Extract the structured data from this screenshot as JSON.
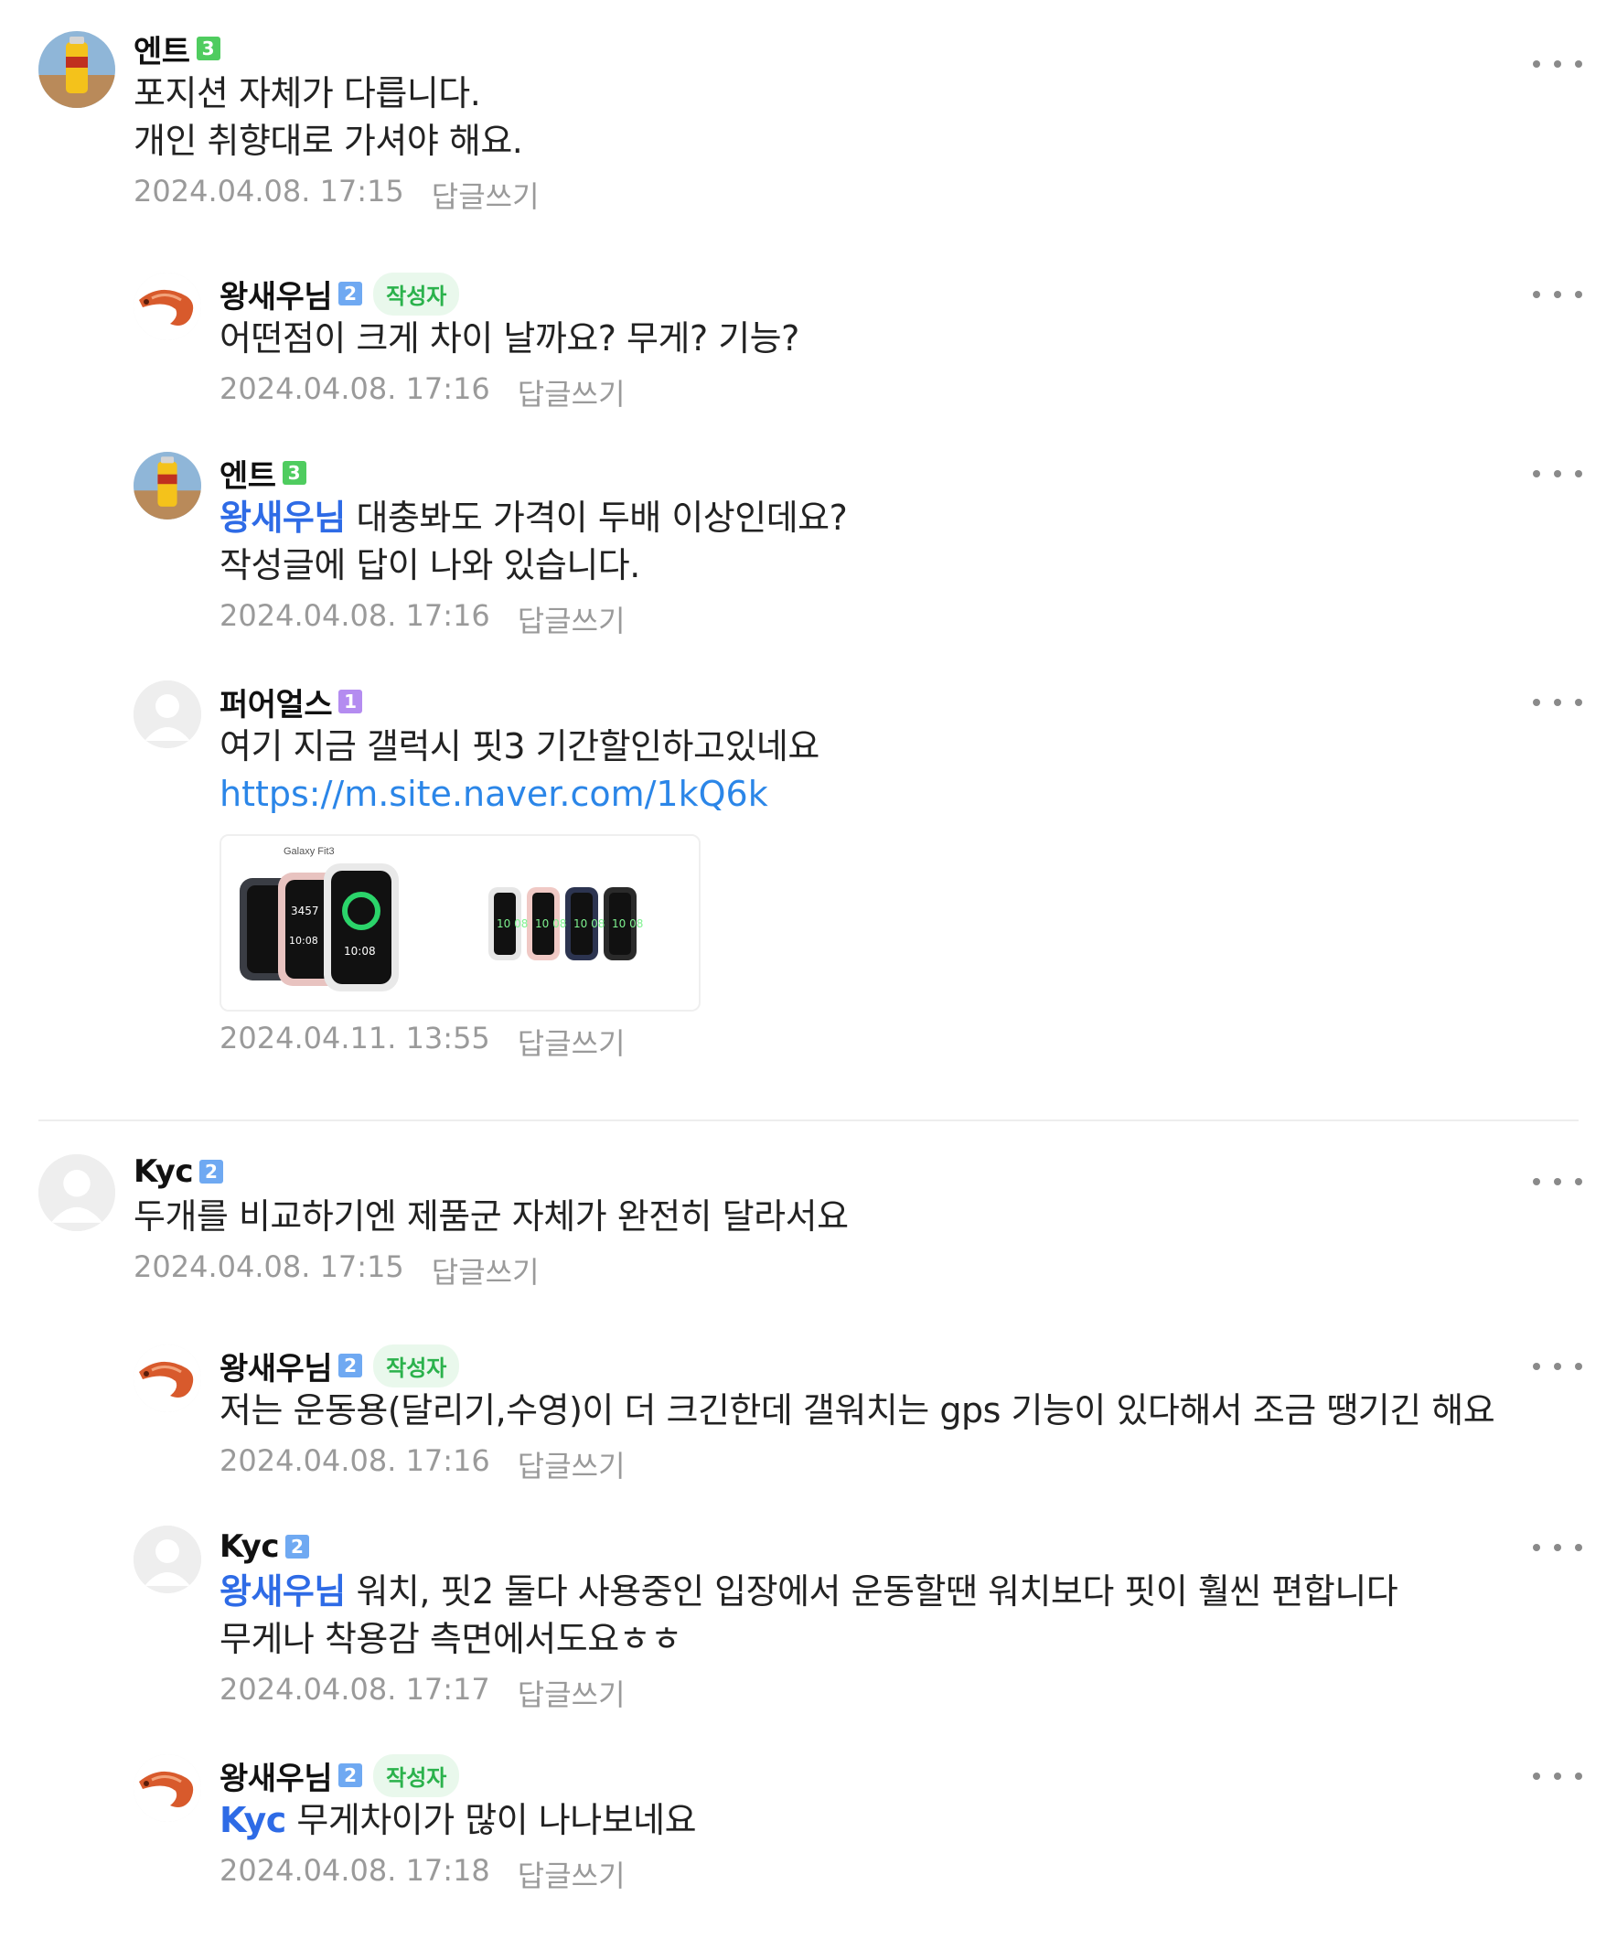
{
  "comments": [
    {
      "nickname": "엔트",
      "level": "3",
      "author_badge": "",
      "lines": [
        "포지션 자체가 다릅니다.",
        "개인 취향대로 가셔야 해요."
      ],
      "mention": "",
      "link": "",
      "date": "2024.04.08. 17:15",
      "reply_label": "답글쓰기",
      "avatar": "cola-icon"
    },
    {
      "nickname": "왕새우님",
      "level": "2",
      "author_badge": "작성자",
      "lines": [
        "어떤점이 크게 차이 날까요? 무게? 기능?"
      ],
      "mention": "",
      "link": "",
      "date": "2024.04.08. 17:16",
      "reply_label": "답글쓰기",
      "avatar": "shrimp-icon"
    },
    {
      "nickname": "엔트",
      "level": "3",
      "author_badge": "",
      "mention": "왕새우님",
      "lines": [
        "대충봐도 가격이 두배 이상인데요?",
        "작성글에 답이 나와 있습니다."
      ],
      "link": "",
      "date": "2024.04.08. 17:16",
      "reply_label": "답글쓰기",
      "avatar": "cola-icon"
    },
    {
      "nickname": "퍼어얼스",
      "level": "1",
      "author_badge": "",
      "lines": [
        "여기 지금 갤럭시 핏3 기간할인하고있네요"
      ],
      "mention": "",
      "link": "https://m.site.naver.com/1kQ6k",
      "thumbnail_caption": "Galaxy Fit3",
      "date": "2024.04.11. 13:55",
      "reply_label": "답글쓰기",
      "avatar": "default-user-icon"
    },
    {
      "nickname": "Kyc",
      "level": "2",
      "author_badge": "",
      "lines": [
        "두개를 비교하기엔 제품군 자체가 완전히 달라서요"
      ],
      "mention": "",
      "link": "",
      "date": "2024.04.08. 17:15",
      "reply_label": "답글쓰기",
      "avatar": "default-user-icon"
    },
    {
      "nickname": "왕새우님",
      "level": "2",
      "author_badge": "작성자",
      "lines": [
        "저는 운동용(달리기,수영)이 더 크긴한데 갤워치는 gps 기능이 있다해서 조금 땡기긴 해요"
      ],
      "mention": "",
      "link": "",
      "date": "2024.04.08. 17:16",
      "reply_label": "답글쓰기",
      "avatar": "shrimp-icon"
    },
    {
      "nickname": "Kyc",
      "level": "2",
      "author_badge": "",
      "mention": "왕새우님",
      "lines": [
        "워치, 핏2 둘다 사용중인 입장에서 운동할땐 워치보다 핏이 훨씬 편합니다",
        "무게나 착용감 측면에서도요ㅎㅎ"
      ],
      "link": "",
      "date": "2024.04.08. 17:17",
      "reply_label": "답글쓰기",
      "avatar": "default-user-icon"
    },
    {
      "nickname": "왕새우님",
      "level": "2",
      "author_badge": "작성자",
      "mention": "Kyc",
      "lines": [
        "무게차이가 많이 나나보네요"
      ],
      "link": "",
      "date": "2024.04.08. 17:18",
      "reply_label": "답글쓰기",
      "avatar": "shrimp-icon"
    }
  ],
  "watch_faces": [
    "3457",
    "10:08",
    "10:08"
  ],
  "band_faces": [
    "10 08",
    "10 08",
    "10 08",
    "10 08"
  ],
  "colors": {
    "mention": "#2e6be6",
    "link": "#2b86e8",
    "level3": "#4fcc5f",
    "level2": "#6fa9f2",
    "level1": "#b48cf0",
    "author_badge": "#2bb24c",
    "meta": "#9a9a9a"
  }
}
